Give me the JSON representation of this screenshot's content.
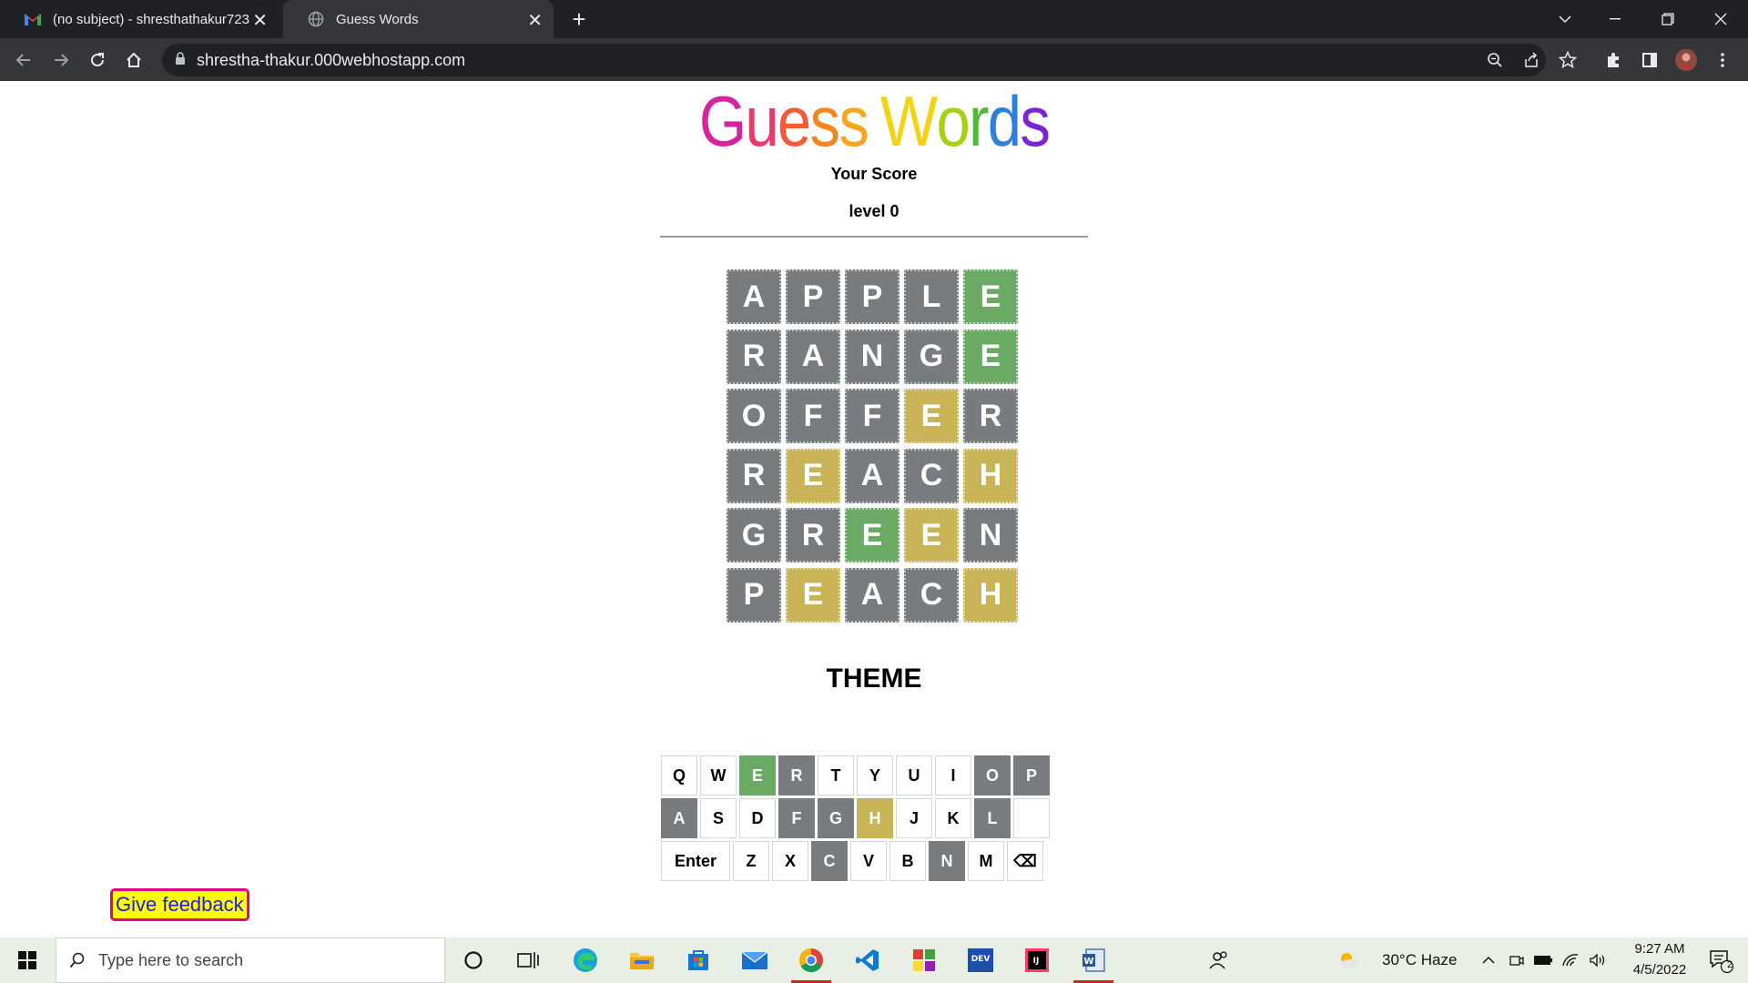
{
  "browser": {
    "tabs": [
      {
        "title": "(no subject) - shresthathakur723",
        "active": false
      },
      {
        "title": "Guess Words",
        "active": true
      }
    ],
    "url": "shrestha-thakur.000webhostapp.com"
  },
  "page": {
    "title_letters": [
      {
        "ch": "G",
        "color": "#d6249f"
      },
      {
        "ch": "u",
        "color": "#ea3a6e"
      },
      {
        "ch": "e",
        "color": "#f25a3a"
      },
      {
        "ch": "s",
        "color": "#f7841e"
      },
      {
        "ch": "s",
        "color": "#f9a61a"
      },
      {
        "ch": " ",
        "color": "#ffffff"
      },
      {
        "ch": "W",
        "color": "#f2d410"
      },
      {
        "ch": "o",
        "color": "#a6d012"
      },
      {
        "ch": "r",
        "color": "#52b83a"
      },
      {
        "ch": "d",
        "color": "#2e7fd8"
      },
      {
        "ch": "s",
        "color": "#7a24d6"
      }
    ],
    "score_label": "Your Score",
    "level_label": "level 0",
    "board": [
      [
        {
          "l": "A",
          "s": "gray"
        },
        {
          "l": "P",
          "s": "gray"
        },
        {
          "l": "P",
          "s": "gray"
        },
        {
          "l": "L",
          "s": "gray"
        },
        {
          "l": "E",
          "s": "green"
        }
      ],
      [
        {
          "l": "R",
          "s": "gray"
        },
        {
          "l": "A",
          "s": "gray"
        },
        {
          "l": "N",
          "s": "gray"
        },
        {
          "l": "G",
          "s": "gray"
        },
        {
          "l": "E",
          "s": "green"
        }
      ],
      [
        {
          "l": "O",
          "s": "gray"
        },
        {
          "l": "F",
          "s": "gray"
        },
        {
          "l": "F",
          "s": "gray"
        },
        {
          "l": "E",
          "s": "yellow"
        },
        {
          "l": "R",
          "s": "gray"
        }
      ],
      [
        {
          "l": "R",
          "s": "gray"
        },
        {
          "l": "E",
          "s": "yellow"
        },
        {
          "l": "A",
          "s": "gray"
        },
        {
          "l": "C",
          "s": "gray"
        },
        {
          "l": "H",
          "s": "yellow"
        }
      ],
      [
        {
          "l": "G",
          "s": "gray"
        },
        {
          "l": "R",
          "s": "gray"
        },
        {
          "l": "E",
          "s": "green"
        },
        {
          "l": "E",
          "s": "yellow"
        },
        {
          "l": "N",
          "s": "gray"
        }
      ],
      [
        {
          "l": "P",
          "s": "gray"
        },
        {
          "l": "E",
          "s": "yellow"
        },
        {
          "l": "A",
          "s": "gray"
        },
        {
          "l": "C",
          "s": "gray"
        },
        {
          "l": "H",
          "s": "yellow"
        }
      ]
    ],
    "theme_label": "THEME",
    "keyboard": [
      [
        {
          "k": "Q",
          "s": ""
        },
        {
          "k": "W",
          "s": ""
        },
        {
          "k": "E",
          "s": "green"
        },
        {
          "k": "R",
          "s": "gray"
        },
        {
          "k": "T",
          "s": ""
        },
        {
          "k": "Y",
          "s": ""
        },
        {
          "k": "U",
          "s": ""
        },
        {
          "k": "I",
          "s": ""
        },
        {
          "k": "O",
          "s": "gray"
        },
        {
          "k": "P",
          "s": "gray"
        }
      ],
      [
        {
          "k": "A",
          "s": "gray"
        },
        {
          "k": "S",
          "s": ""
        },
        {
          "k": "D",
          "s": ""
        },
        {
          "k": "F",
          "s": "gray"
        },
        {
          "k": "G",
          "s": "gray"
        },
        {
          "k": "H",
          "s": "yellow"
        },
        {
          "k": "J",
          "s": ""
        },
        {
          "k": "K",
          "s": ""
        },
        {
          "k": "L",
          "s": "gray"
        },
        {
          "k": "",
          "s": ""
        }
      ],
      [
        {
          "k": "Enter",
          "s": "",
          "wide": true
        },
        {
          "k": "Z",
          "s": ""
        },
        {
          "k": "X",
          "s": ""
        },
        {
          "k": "C",
          "s": "gray"
        },
        {
          "k": "V",
          "s": ""
        },
        {
          "k": "B",
          "s": ""
        },
        {
          "k": "N",
          "s": "gray"
        },
        {
          "k": "M",
          "s": ""
        },
        {
          "k": "⌫",
          "s": ""
        }
      ]
    ],
    "feedback_label": "Give feedback"
  },
  "colors": {
    "gray": "#787c7e",
    "green": "#6aaa64",
    "yellow": "#c9b458",
    "feedback_bg": "#ffff00",
    "feedback_border": "#e4007c",
    "feedback_text": "#1d1ddb"
  },
  "taskbar": {
    "search_placeholder": "Type here to search",
    "weather": "30°C  Haze",
    "time": "9:27 AM",
    "date": "4/5/2022",
    "notification_count": "2"
  }
}
